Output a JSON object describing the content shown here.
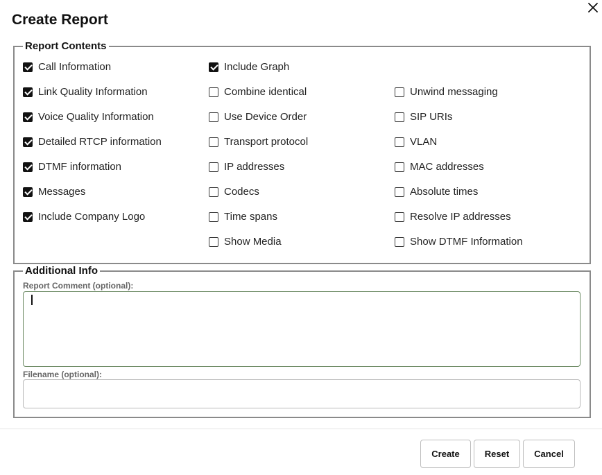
{
  "dialog": {
    "title": "Create Report"
  },
  "report_contents": {
    "legend": "Report Contents",
    "col1": [
      {
        "label": "Call Information",
        "checked": true
      },
      {
        "label": "Link Quality Information",
        "checked": true
      },
      {
        "label": "Voice Quality Information",
        "checked": true
      },
      {
        "label": "Detailed RTCP information",
        "checked": true
      },
      {
        "label": "DTMF information",
        "checked": true
      },
      {
        "label": "Messages",
        "checked": true
      },
      {
        "label": "Include Company Logo",
        "checked": true
      }
    ],
    "col2": [
      {
        "label": "Include Graph",
        "checked": true
      },
      {
        "label": "Combine identical",
        "checked": false
      },
      {
        "label": "Use Device Order",
        "checked": false
      },
      {
        "label": "Transport protocol",
        "checked": false
      },
      {
        "label": "IP addresses",
        "checked": false
      },
      {
        "label": "Codecs",
        "checked": false
      },
      {
        "label": "Time spans",
        "checked": false
      },
      {
        "label": "Show Media",
        "checked": false
      }
    ],
    "col3": [
      {
        "label": "Unwind messaging",
        "checked": false
      },
      {
        "label": "SIP URIs",
        "checked": false
      },
      {
        "label": "VLAN",
        "checked": false
      },
      {
        "label": "MAC addresses",
        "checked": false
      },
      {
        "label": "Absolute times",
        "checked": false
      },
      {
        "label": "Resolve IP addresses",
        "checked": false
      },
      {
        "label": "Show DTMF Information",
        "checked": false
      }
    ]
  },
  "additional_info": {
    "legend": "Additional Info",
    "comment_label": "Report Comment (optional):",
    "comment_value": "",
    "filename_label": "Filename (optional):",
    "filename_value": ""
  },
  "buttons": {
    "create": "Create",
    "reset": "Reset",
    "cancel": "Cancel"
  },
  "icons": {
    "close": "close-icon",
    "check": "checkmark-icon"
  }
}
